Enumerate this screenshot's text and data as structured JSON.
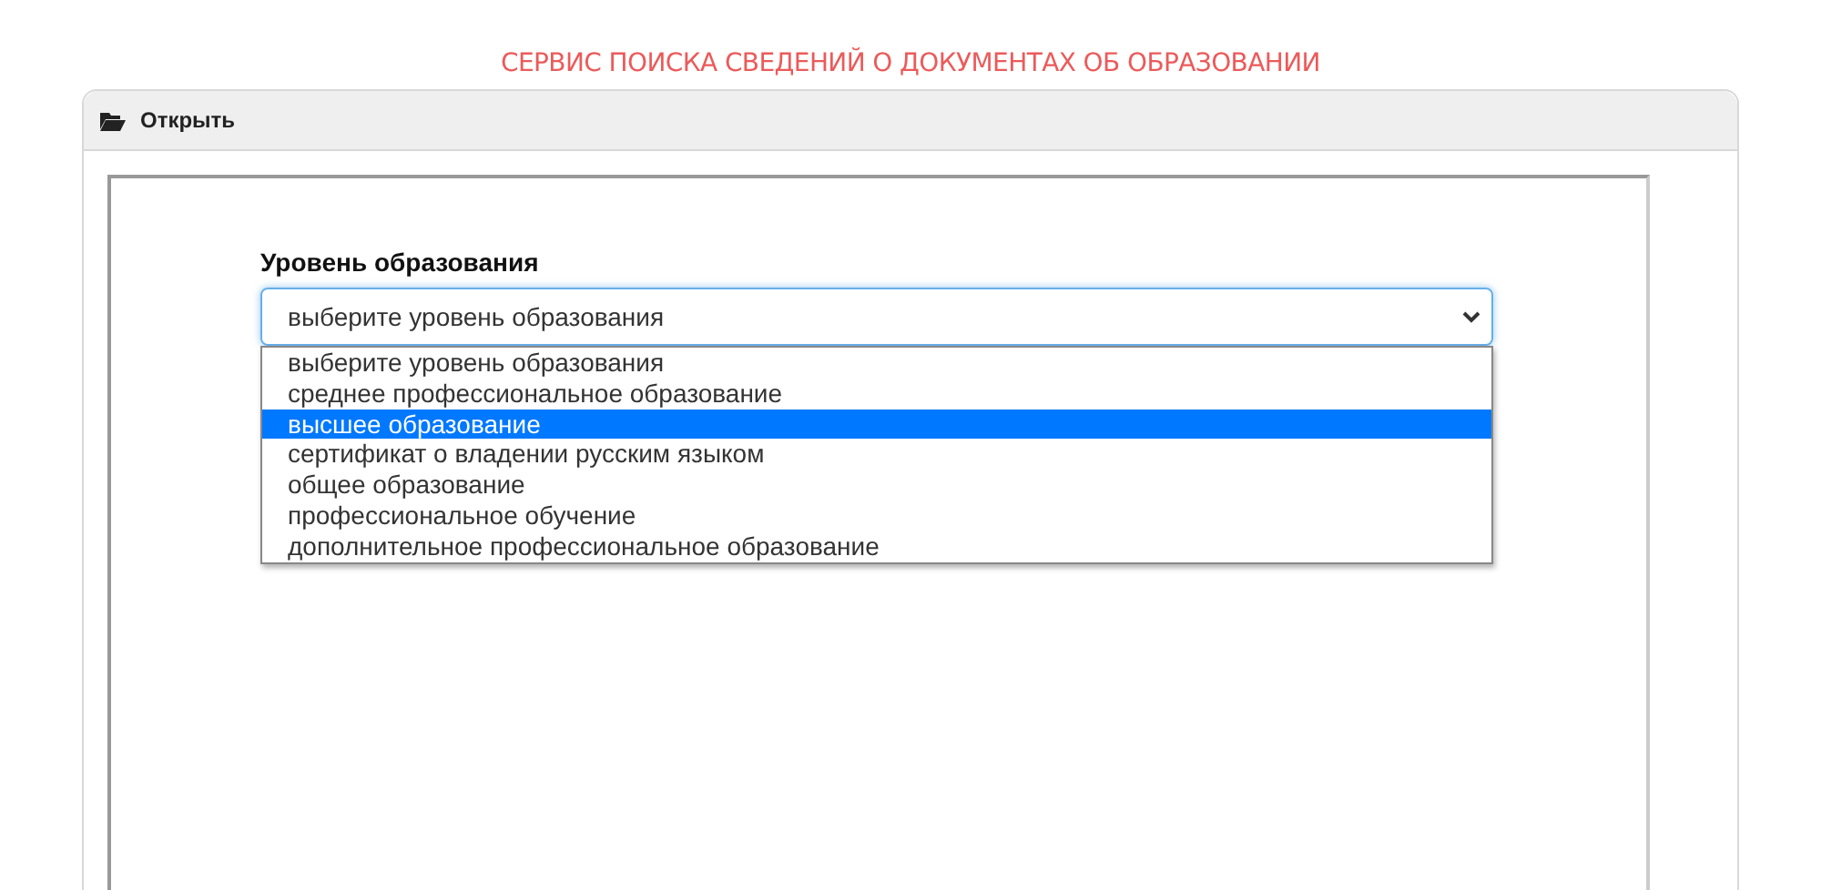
{
  "page_title": "СЕРВИС ПОИСКА СВЕДЕНИЙ О ДОКУМЕНТАХ ОБ ОБРАЗОВАНИИ",
  "panel": {
    "header": "Открыть"
  },
  "field": {
    "label": "Уровень образования",
    "value": "выберите уровень образования",
    "expanded": true,
    "options": [
      {
        "label": "выберите уровень образования",
        "highlighted": false
      },
      {
        "label": "среднее профессиональное образование",
        "highlighted": false
      },
      {
        "label": "высшее образование",
        "highlighted": true
      },
      {
        "label": "сертификат о владении русским языком",
        "highlighted": false
      },
      {
        "label": "общее образование",
        "highlighted": false
      },
      {
        "label": "профессиональное обучение",
        "highlighted": false
      },
      {
        "label": "дополнительное профессиональное образование",
        "highlighted": false
      }
    ]
  }
}
